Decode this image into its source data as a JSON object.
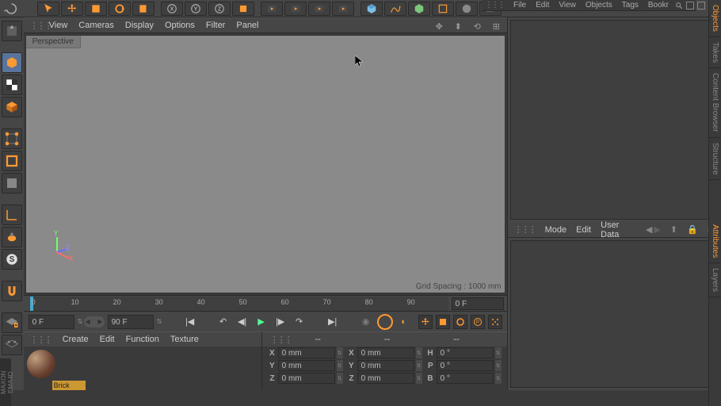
{
  "top_tabs": {
    "file": "File",
    "edit": "Edit",
    "view": "View",
    "objects": "Objects",
    "tags": "Tags",
    "bookmarks": "Bookr"
  },
  "viewport_menu": {
    "view": "View",
    "cameras": "Cameras",
    "display": "Display",
    "options": "Options",
    "filter": "Filter",
    "panel": "Panel"
  },
  "viewport": {
    "tab": "Perspective",
    "grid_spacing": "Grid Spacing : 1000 mm",
    "axis": {
      "x": "X",
      "y": "Y",
      "z": "Z"
    }
  },
  "timeline": {
    "ticks": [
      "0",
      "10",
      "20",
      "30",
      "40",
      "50",
      "60",
      "70",
      "80",
      "90"
    ],
    "current": "0 F",
    "start": "0 F",
    "end": "90 F"
  },
  "attr_menu": {
    "mode": "Mode",
    "edit": "Edit",
    "user_data": "User Data"
  },
  "materials": {
    "menu": {
      "create": "Create",
      "edit": "Edit",
      "function": "Function",
      "texture": "Texture"
    },
    "item_name": "Brick"
  },
  "coords": {
    "header": {
      "c1": "--",
      "c2": "--",
      "c3": "--"
    },
    "rows": [
      {
        "a": "X",
        "av": "0 mm",
        "b": "X",
        "bv": "0 mm",
        "c": "H",
        "cv": "0 °"
      },
      {
        "a": "Y",
        "av": "0 mm",
        "b": "Y",
        "bv": "0 mm",
        "c": "P",
        "cv": "0 °"
      },
      {
        "a": "Z",
        "av": "0 mm",
        "b": "Z",
        "bv": "0 mm",
        "c": "B",
        "cv": "0 °"
      }
    ]
  },
  "right_tabs": {
    "objects": "Objects",
    "takes": "Takes",
    "content": "Content Browser",
    "structure": "Structure",
    "attributes": "Attributes",
    "layers": "Layers"
  },
  "brand": "MAXON EMA4D"
}
